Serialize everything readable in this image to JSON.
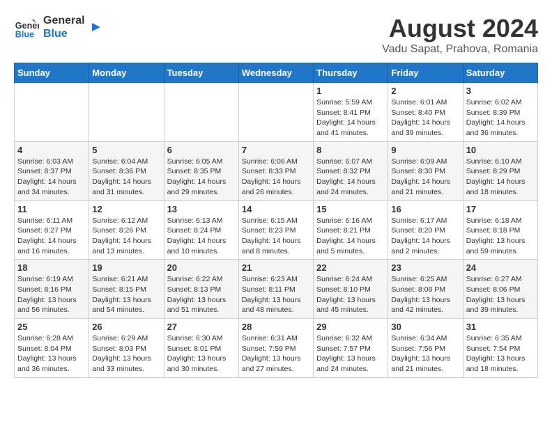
{
  "logo": {
    "line1": "General",
    "line2": "Blue"
  },
  "title": "August 2024",
  "location": "Vadu Sapat, Prahova, Romania",
  "weekdays": [
    "Sunday",
    "Monday",
    "Tuesday",
    "Wednesday",
    "Thursday",
    "Friday",
    "Saturday"
  ],
  "weeks": [
    [
      {
        "day": "",
        "info": ""
      },
      {
        "day": "",
        "info": ""
      },
      {
        "day": "",
        "info": ""
      },
      {
        "day": "",
        "info": ""
      },
      {
        "day": "1",
        "info": "Sunrise: 5:59 AM\nSunset: 8:41 PM\nDaylight: 14 hours and 41 minutes."
      },
      {
        "day": "2",
        "info": "Sunrise: 6:01 AM\nSunset: 8:40 PM\nDaylight: 14 hours and 39 minutes."
      },
      {
        "day": "3",
        "info": "Sunrise: 6:02 AM\nSunset: 8:39 PM\nDaylight: 14 hours and 36 minutes."
      }
    ],
    [
      {
        "day": "4",
        "info": "Sunrise: 6:03 AM\nSunset: 8:37 PM\nDaylight: 14 hours and 34 minutes."
      },
      {
        "day": "5",
        "info": "Sunrise: 6:04 AM\nSunset: 8:36 PM\nDaylight: 14 hours and 31 minutes."
      },
      {
        "day": "6",
        "info": "Sunrise: 6:05 AM\nSunset: 8:35 PM\nDaylight: 14 hours and 29 minutes."
      },
      {
        "day": "7",
        "info": "Sunrise: 6:06 AM\nSunset: 8:33 PM\nDaylight: 14 hours and 26 minutes."
      },
      {
        "day": "8",
        "info": "Sunrise: 6:07 AM\nSunset: 8:32 PM\nDaylight: 14 hours and 24 minutes."
      },
      {
        "day": "9",
        "info": "Sunrise: 6:09 AM\nSunset: 8:30 PM\nDaylight: 14 hours and 21 minutes."
      },
      {
        "day": "10",
        "info": "Sunrise: 6:10 AM\nSunset: 8:29 PM\nDaylight: 14 hours and 18 minutes."
      }
    ],
    [
      {
        "day": "11",
        "info": "Sunrise: 6:11 AM\nSunset: 8:27 PM\nDaylight: 14 hours and 16 minutes."
      },
      {
        "day": "12",
        "info": "Sunrise: 6:12 AM\nSunset: 8:26 PM\nDaylight: 14 hours and 13 minutes."
      },
      {
        "day": "13",
        "info": "Sunrise: 6:13 AM\nSunset: 8:24 PM\nDaylight: 14 hours and 10 minutes."
      },
      {
        "day": "14",
        "info": "Sunrise: 6:15 AM\nSunset: 8:23 PM\nDaylight: 14 hours and 8 minutes."
      },
      {
        "day": "15",
        "info": "Sunrise: 6:16 AM\nSunset: 8:21 PM\nDaylight: 14 hours and 5 minutes."
      },
      {
        "day": "16",
        "info": "Sunrise: 6:17 AM\nSunset: 8:20 PM\nDaylight: 14 hours and 2 minutes."
      },
      {
        "day": "17",
        "info": "Sunrise: 6:18 AM\nSunset: 8:18 PM\nDaylight: 13 hours and 59 minutes."
      }
    ],
    [
      {
        "day": "18",
        "info": "Sunrise: 6:19 AM\nSunset: 8:16 PM\nDaylight: 13 hours and 56 minutes."
      },
      {
        "day": "19",
        "info": "Sunrise: 6:21 AM\nSunset: 8:15 PM\nDaylight: 13 hours and 54 minutes."
      },
      {
        "day": "20",
        "info": "Sunrise: 6:22 AM\nSunset: 8:13 PM\nDaylight: 13 hours and 51 minutes."
      },
      {
        "day": "21",
        "info": "Sunrise: 6:23 AM\nSunset: 8:11 PM\nDaylight: 13 hours and 48 minutes."
      },
      {
        "day": "22",
        "info": "Sunrise: 6:24 AM\nSunset: 8:10 PM\nDaylight: 13 hours and 45 minutes."
      },
      {
        "day": "23",
        "info": "Sunrise: 6:25 AM\nSunset: 8:08 PM\nDaylight: 13 hours and 42 minutes."
      },
      {
        "day": "24",
        "info": "Sunrise: 6:27 AM\nSunset: 8:06 PM\nDaylight: 13 hours and 39 minutes."
      }
    ],
    [
      {
        "day": "25",
        "info": "Sunrise: 6:28 AM\nSunset: 8:04 PM\nDaylight: 13 hours and 36 minutes."
      },
      {
        "day": "26",
        "info": "Sunrise: 6:29 AM\nSunset: 8:03 PM\nDaylight: 13 hours and 33 minutes."
      },
      {
        "day": "27",
        "info": "Sunrise: 6:30 AM\nSunset: 8:01 PM\nDaylight: 13 hours and 30 minutes."
      },
      {
        "day": "28",
        "info": "Sunrise: 6:31 AM\nSunset: 7:59 PM\nDaylight: 13 hours and 27 minutes."
      },
      {
        "day": "29",
        "info": "Sunrise: 6:32 AM\nSunset: 7:57 PM\nDaylight: 13 hours and 24 minutes."
      },
      {
        "day": "30",
        "info": "Sunrise: 6:34 AM\nSunset: 7:56 PM\nDaylight: 13 hours and 21 minutes."
      },
      {
        "day": "31",
        "info": "Sunrise: 6:35 AM\nSunset: 7:54 PM\nDaylight: 13 hours and 18 minutes."
      }
    ]
  ]
}
